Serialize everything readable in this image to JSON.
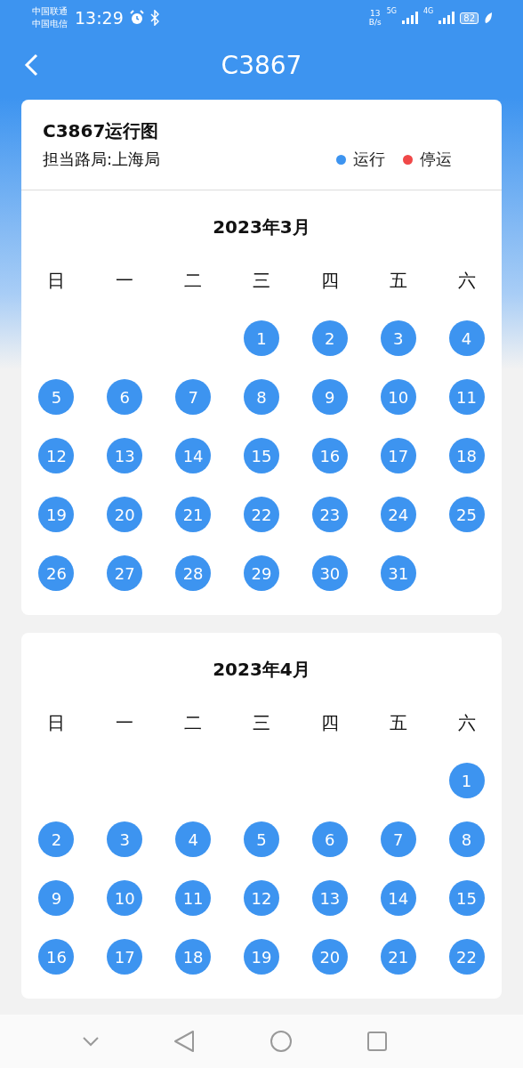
{
  "status_bar": {
    "carriers": [
      "中国联通",
      "中国电信"
    ],
    "time": "13:29",
    "speed_value": "13",
    "speed_unit": "B/s",
    "networks": [
      "5G",
      "4G"
    ],
    "battery": "82"
  },
  "header": {
    "title": "C3867"
  },
  "info": {
    "title": "C3867运行图",
    "bureau": "担当路局:上海局",
    "legend": [
      {
        "label": "运行",
        "color": "#3d94f0"
      },
      {
        "label": "停运",
        "color": "#f04848"
      }
    ]
  },
  "months": [
    {
      "title": "2023年3月",
      "weekdays": [
        "日",
        "一",
        "二",
        "三",
        "四",
        "五",
        "六"
      ],
      "weeks": [
        [
          {
            "kind": "blank"
          },
          {
            "kind": "blank"
          },
          {
            "kind": "blank"
          },
          {
            "day": "1",
            "running": true
          },
          {
            "day": "2",
            "running": true
          },
          {
            "day": "3",
            "running": true
          },
          {
            "day": "4",
            "running": true
          }
        ],
        [
          {
            "day": "5",
            "running": true
          },
          {
            "day": "6",
            "running": true
          },
          {
            "day": "7",
            "running": true
          },
          {
            "day": "8",
            "running": true
          },
          {
            "day": "9",
            "running": true
          },
          {
            "day": "10",
            "running": true
          },
          {
            "day": "11",
            "running": true
          }
        ],
        [
          {
            "day": "12",
            "running": true
          },
          {
            "day": "13",
            "running": true
          },
          {
            "day": "14",
            "running": true
          },
          {
            "day": "15",
            "running": true
          },
          {
            "day": "16",
            "running": true
          },
          {
            "day": "17",
            "running": true
          },
          {
            "day": "18",
            "running": true
          }
        ],
        [
          {
            "day": "19",
            "running": true
          },
          {
            "day": "20",
            "running": true
          },
          {
            "day": "21",
            "running": true
          },
          {
            "day": "22",
            "running": true
          },
          {
            "day": "23",
            "running": true
          },
          {
            "day": "24",
            "running": true
          },
          {
            "day": "25",
            "running": true
          }
        ],
        [
          {
            "day": "26",
            "running": true
          },
          {
            "day": "27",
            "running": true
          },
          {
            "day": "28",
            "running": true
          },
          {
            "day": "29",
            "running": true
          },
          {
            "day": "30",
            "running": true
          },
          {
            "day": "31",
            "running": true
          },
          {
            "kind": "blank"
          }
        ]
      ]
    },
    {
      "title": "2023年4月",
      "weekdays": [
        "日",
        "一",
        "二",
        "三",
        "四",
        "五",
        "六"
      ],
      "weeks": [
        [
          {
            "kind": "blank"
          },
          {
            "kind": "blank"
          },
          {
            "kind": "blank"
          },
          {
            "kind": "blank"
          },
          {
            "kind": "blank"
          },
          {
            "kind": "blank"
          },
          {
            "day": "1",
            "running": true
          }
        ],
        [
          {
            "day": "2",
            "running": true
          },
          {
            "day": "3",
            "running": true
          },
          {
            "day": "4",
            "running": true
          },
          {
            "day": "5",
            "running": true
          },
          {
            "day": "6",
            "running": true
          },
          {
            "day": "7",
            "running": true
          },
          {
            "day": "8",
            "running": true
          }
        ],
        [
          {
            "day": "9",
            "running": true
          },
          {
            "day": "10",
            "running": true
          },
          {
            "day": "11",
            "running": true
          },
          {
            "day": "12",
            "running": true
          },
          {
            "day": "13",
            "running": true
          },
          {
            "day": "14",
            "running": true
          },
          {
            "day": "15",
            "running": true
          }
        ],
        [
          {
            "day": "16",
            "running": true
          },
          {
            "day": "17",
            "running": true
          },
          {
            "day": "18",
            "running": true
          },
          {
            "day": "19",
            "running": true
          },
          {
            "day": "20",
            "running": true
          },
          {
            "day": "21",
            "running": true
          },
          {
            "day": "22",
            "running": true
          }
        ]
      ]
    }
  ]
}
